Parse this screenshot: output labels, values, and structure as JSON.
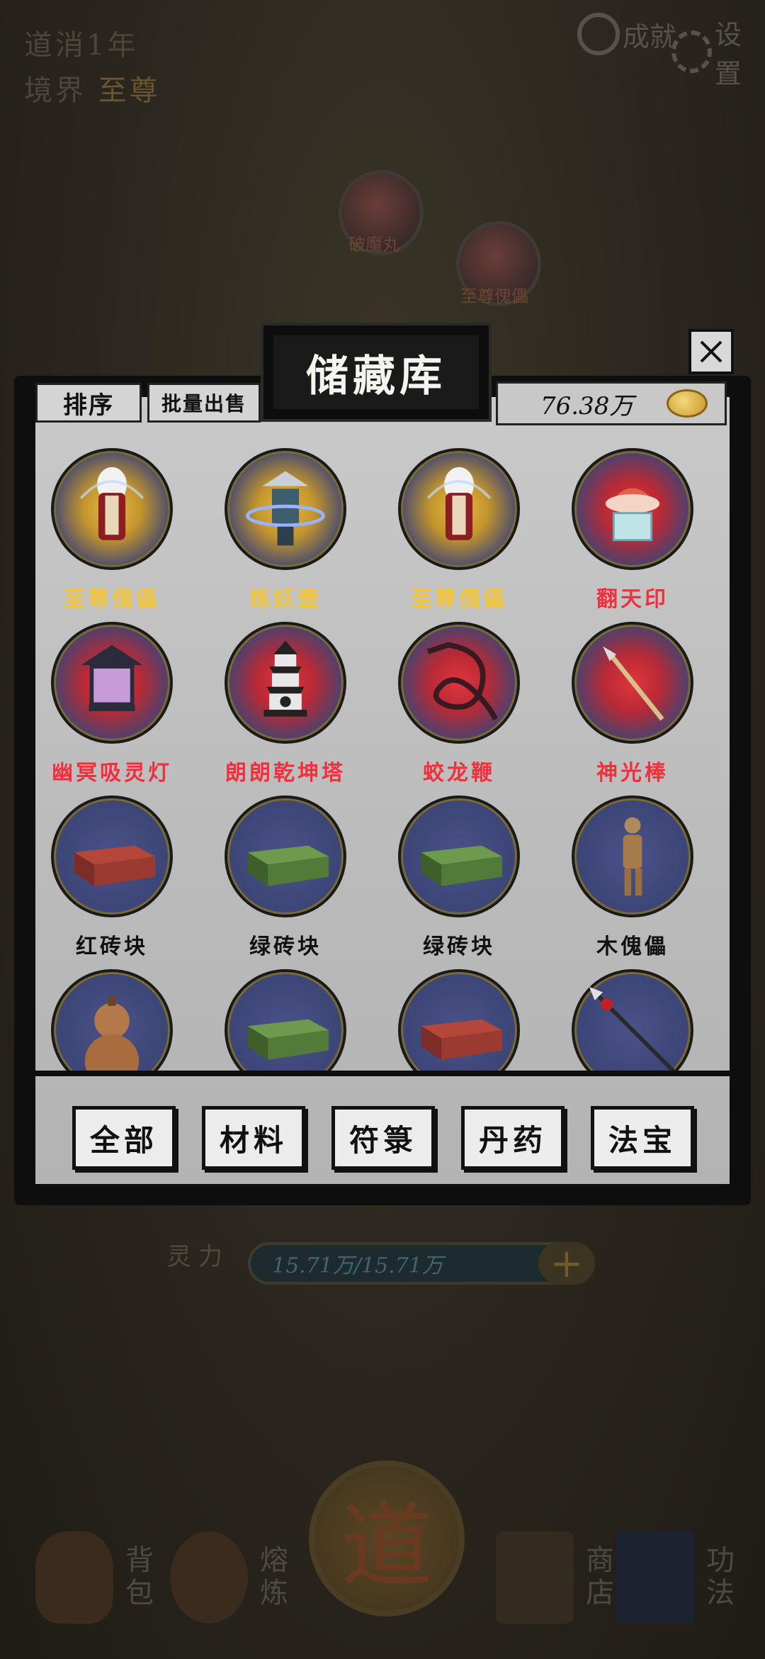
{
  "header": {
    "dao_label": "道消1年",
    "realm_label": "境界",
    "realm_value": "至尊",
    "achievement_label": "成就",
    "settings_label": "设置"
  },
  "scene": {
    "orb_labels": [
      "破魔丸",
      "至尊傀儡"
    ],
    "spirit_label": "灵力",
    "spirit_value": "15.71万/15.71万",
    "dao_glyph": "道"
  },
  "dialog": {
    "title": "储藏库",
    "sort_label": "排序",
    "bulk_sell_label": "批量出售",
    "coins": "76.38万",
    "items": [
      {
        "name": "至尊傀儡",
        "rarity": "gold",
        "icon": "puppet-icon"
      },
      {
        "name": "炼妖壶",
        "rarity": "gold",
        "icon": "lantern-pot-icon"
      },
      {
        "name": "至尊傀儡",
        "rarity": "gold",
        "icon": "puppet-icon"
      },
      {
        "name": "翻天印",
        "rarity": "red",
        "icon": "seal-icon"
      },
      {
        "name": "幽冥吸灵灯",
        "rarity": "red",
        "icon": "lamp-icon"
      },
      {
        "name": "朗朗乾坤塔",
        "rarity": "red",
        "icon": "pagoda-icon"
      },
      {
        "name": "蛟龙鞭",
        "rarity": "red",
        "icon": "whip-icon"
      },
      {
        "name": "神光棒",
        "rarity": "red",
        "icon": "staff-icon"
      },
      {
        "name": "红砖块",
        "rarity": "white",
        "icon": "red-brick-icon"
      },
      {
        "name": "绿砖块",
        "rarity": "white",
        "icon": "green-brick-icon"
      },
      {
        "name": "绿砖块",
        "rarity": "white",
        "icon": "green-brick-icon"
      },
      {
        "name": "木傀儡",
        "rarity": "white",
        "icon": "wood-puppet-icon"
      },
      {
        "name": "",
        "rarity": "white",
        "icon": "gourd-icon"
      },
      {
        "name": "",
        "rarity": "white",
        "icon": "green-brick-icon"
      },
      {
        "name": "",
        "rarity": "white",
        "icon": "red-brick-icon"
      },
      {
        "name": "",
        "rarity": "white",
        "icon": "spear-icon"
      }
    ],
    "tabs": [
      "全部",
      "材料",
      "符箓",
      "丹药",
      "法宝"
    ]
  },
  "bottom_nav": [
    {
      "label": "背包",
      "icon": "bag-icon"
    },
    {
      "label": "熔炼",
      "icon": "smelt-icon"
    },
    {
      "label": "商店",
      "icon": "scroll-icon"
    },
    {
      "label": "功法",
      "icon": "book-icon"
    }
  ],
  "colors": {
    "gold_rarity": "#f3c637",
    "red_rarity": "#f0303c",
    "common_rarity": "#111111",
    "panel_bg": "#c4c4c4",
    "frame": "#0e0e0e"
  }
}
